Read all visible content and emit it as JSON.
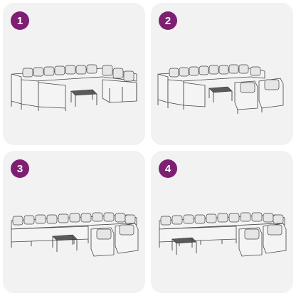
{
  "colors": {
    "badge": "#7e1f73",
    "panel_bg": "#f2f2f2",
    "line": "#444444"
  },
  "panels": [
    {
      "number": "1",
      "illustration": "sofa-set-arrangement-1"
    },
    {
      "number": "2",
      "illustration": "sofa-set-arrangement-2"
    },
    {
      "number": "3",
      "illustration": "sofa-set-arrangement-3"
    },
    {
      "number": "4",
      "illustration": "sofa-set-arrangement-4"
    }
  ]
}
